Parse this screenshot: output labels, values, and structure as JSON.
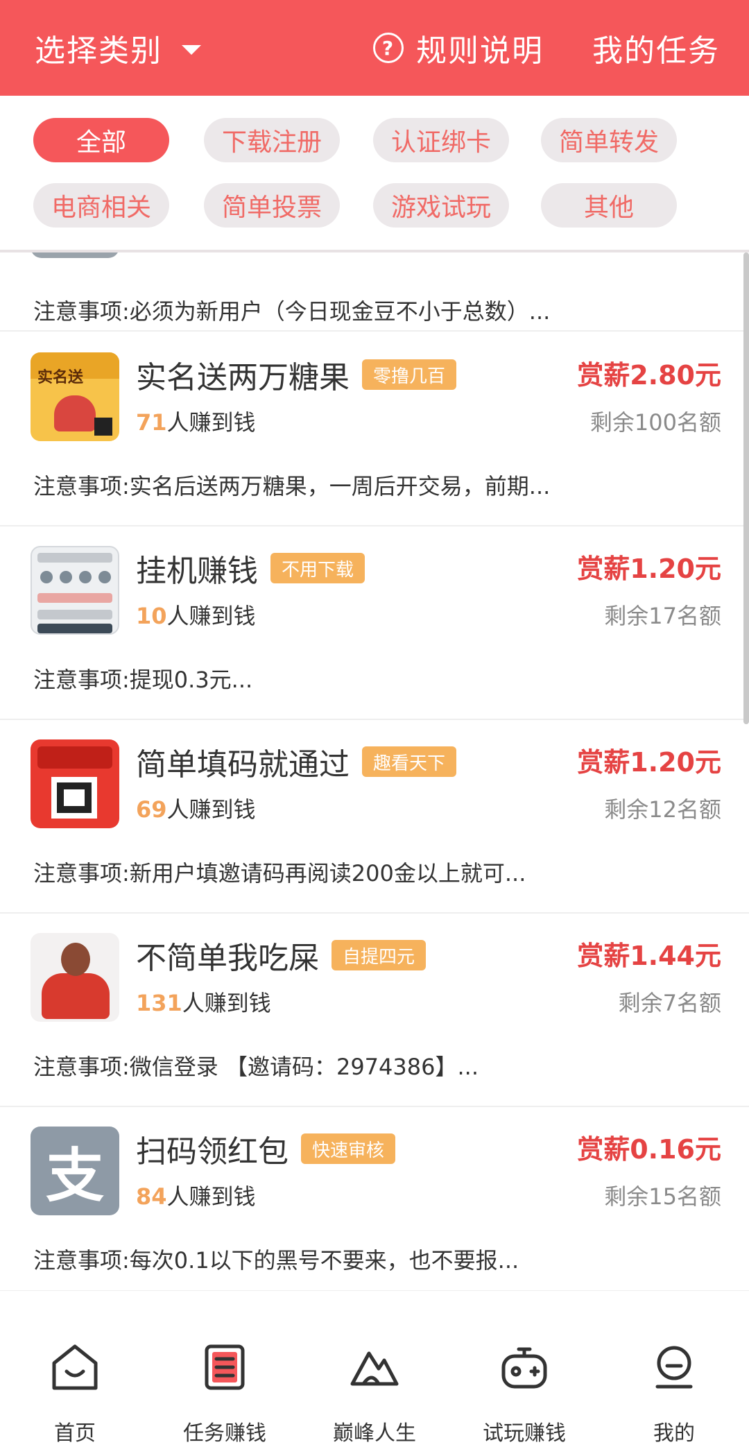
{
  "header": {
    "category_label": "选择类别",
    "rules_label": "规则说明",
    "rules_icon": "?",
    "my_tasks_label": "我的任务"
  },
  "filters": [
    {
      "label": "全部",
      "active": true
    },
    {
      "label": "下载注册",
      "active": false
    },
    {
      "label": "认证绑卡",
      "active": false
    },
    {
      "label": "简单转发",
      "active": false
    },
    {
      "label": "电商相关",
      "active": false
    },
    {
      "label": "简单投票",
      "active": false
    },
    {
      "label": "游戏试玩",
      "active": false
    },
    {
      "label": "其他",
      "active": false
    }
  ],
  "partial_task": {
    "note": "注意事项:必须为新用户（今日现金豆不小于总数）..."
  },
  "tasks": [
    {
      "title": "实名送两万糖果",
      "tag": "零撸几百",
      "earned_count": "71",
      "earned_suffix": "人赚到钱",
      "reward": "赏薪2.80元",
      "remaining": "剩余100名额",
      "note": "注意事项:实名后送两万糖果，一周后开交易，前期...",
      "thumb_icon": "candy-promo-icon",
      "thumb_text": "实名送"
    },
    {
      "title": "挂机赚钱",
      "tag": "不用下载",
      "earned_count": "10",
      "earned_suffix": "人赚到钱",
      "reward": "赏薪1.20元",
      "remaining": "剩余17名额",
      "note": "注意事项:提现0.3元...",
      "thumb_icon": "phone-screenshot-icon"
    },
    {
      "title": "简单填码就通过",
      "tag": "趣看天下",
      "earned_count": "69",
      "earned_suffix": "人赚到钱",
      "reward": "赏薪1.20元",
      "remaining": "剩余12名额",
      "note": "注意事项:新用户填邀请码再阅读200金以上就可...",
      "thumb_icon": "qr-code-promo-icon"
    },
    {
      "title": "不简单我吃屎",
      "tag": "自提四元",
      "earned_count": "131",
      "earned_suffix": "人赚到钱",
      "reward": "赏薪1.44元",
      "remaining": "剩余7名额",
      "note": "注意事项:微信登录 【邀请码：2974386】...",
      "thumb_icon": "person-photo-icon"
    },
    {
      "title": "扫码领红包",
      "tag": "快速审核",
      "earned_count": "84",
      "earned_suffix": "人赚到钱",
      "reward": "赏薪0.16元",
      "remaining": "剩余15名额",
      "note": "注意事项:每次0.1以下的黑号不要来，也不要报...",
      "thumb_icon": "alipay-icon",
      "thumb_text": "支"
    }
  ],
  "bottom_nav": [
    {
      "label": "首页",
      "icon": "home-icon"
    },
    {
      "label": "任务赚钱",
      "icon": "task-list-icon"
    },
    {
      "label": "巅峰人生",
      "icon": "mountain-icon"
    },
    {
      "label": "试玩赚钱",
      "icon": "gamepad-icon"
    },
    {
      "label": "我的",
      "icon": "profile-icon"
    }
  ],
  "colors": {
    "brand": "#f5575a",
    "reward": "#e54343",
    "tag": "#f6b25c",
    "earned": "#f3a35b",
    "muted": "#8a8a8a"
  }
}
